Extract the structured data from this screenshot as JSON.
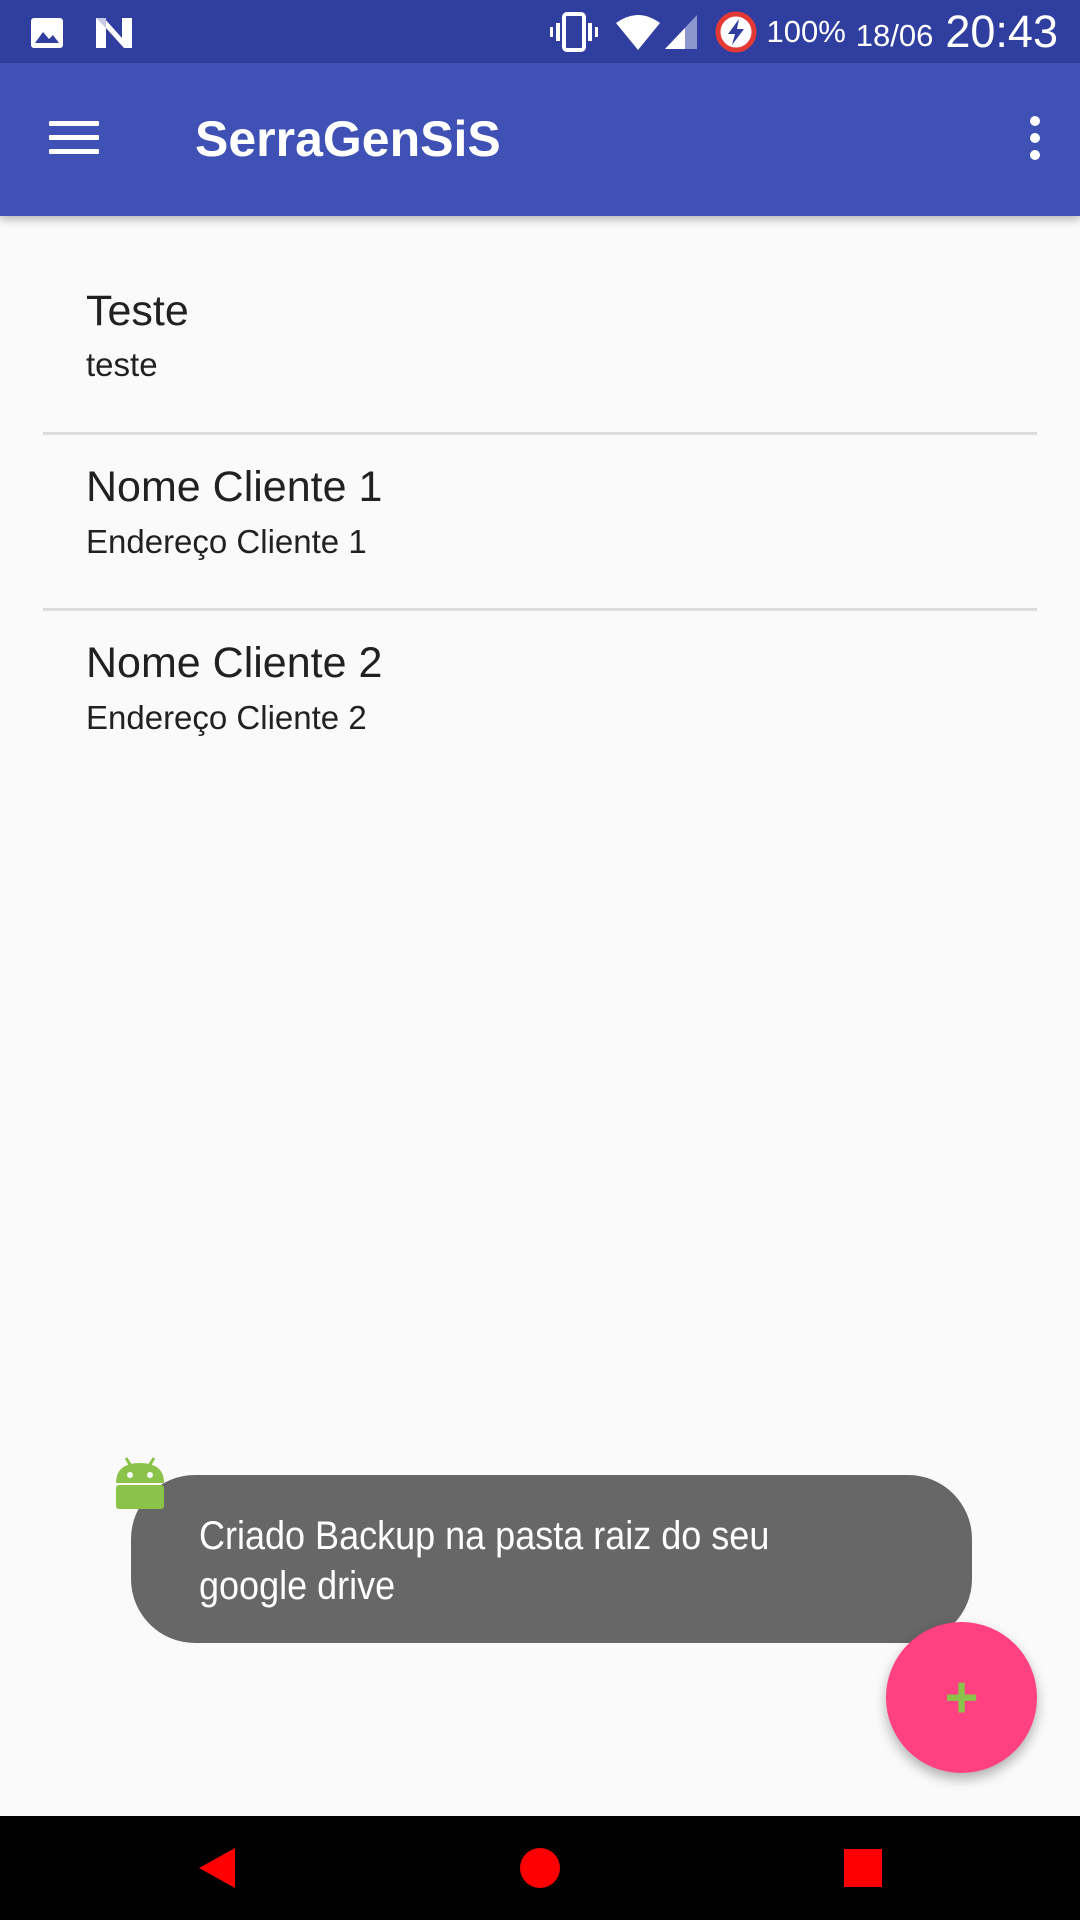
{
  "status_bar": {
    "battery_percent": "100%",
    "date": "18/06",
    "time": "20:43",
    "icons": [
      "image-icon",
      "n-icon",
      "vibrate-icon",
      "wifi-icon",
      "signal-icon",
      "battery-charging-icon"
    ]
  },
  "app_bar": {
    "title": "SerraGenSiS",
    "icons": [
      "menu-icon",
      "more-vert-icon"
    ]
  },
  "list": {
    "items": [
      {
        "title": "Teste",
        "subtitle": "teste"
      },
      {
        "title": "Nome Cliente 1",
        "subtitle": "Endereço Cliente 1"
      },
      {
        "title": "Nome Cliente 2",
        "subtitle": "Endereço Cliente 2"
      }
    ]
  },
  "toast": {
    "message": "Criado Backup na pasta raiz do seu google drive"
  },
  "fab": {
    "label": "+",
    "color": "#ff4081"
  },
  "nav_bar": {
    "icons": [
      "back-icon",
      "home-icon",
      "recents-icon"
    ],
    "color": "#ff0000"
  },
  "colors": {
    "primary": "#3f51b5",
    "primary_dark": "#303f9f",
    "accent": "#ff4081"
  }
}
